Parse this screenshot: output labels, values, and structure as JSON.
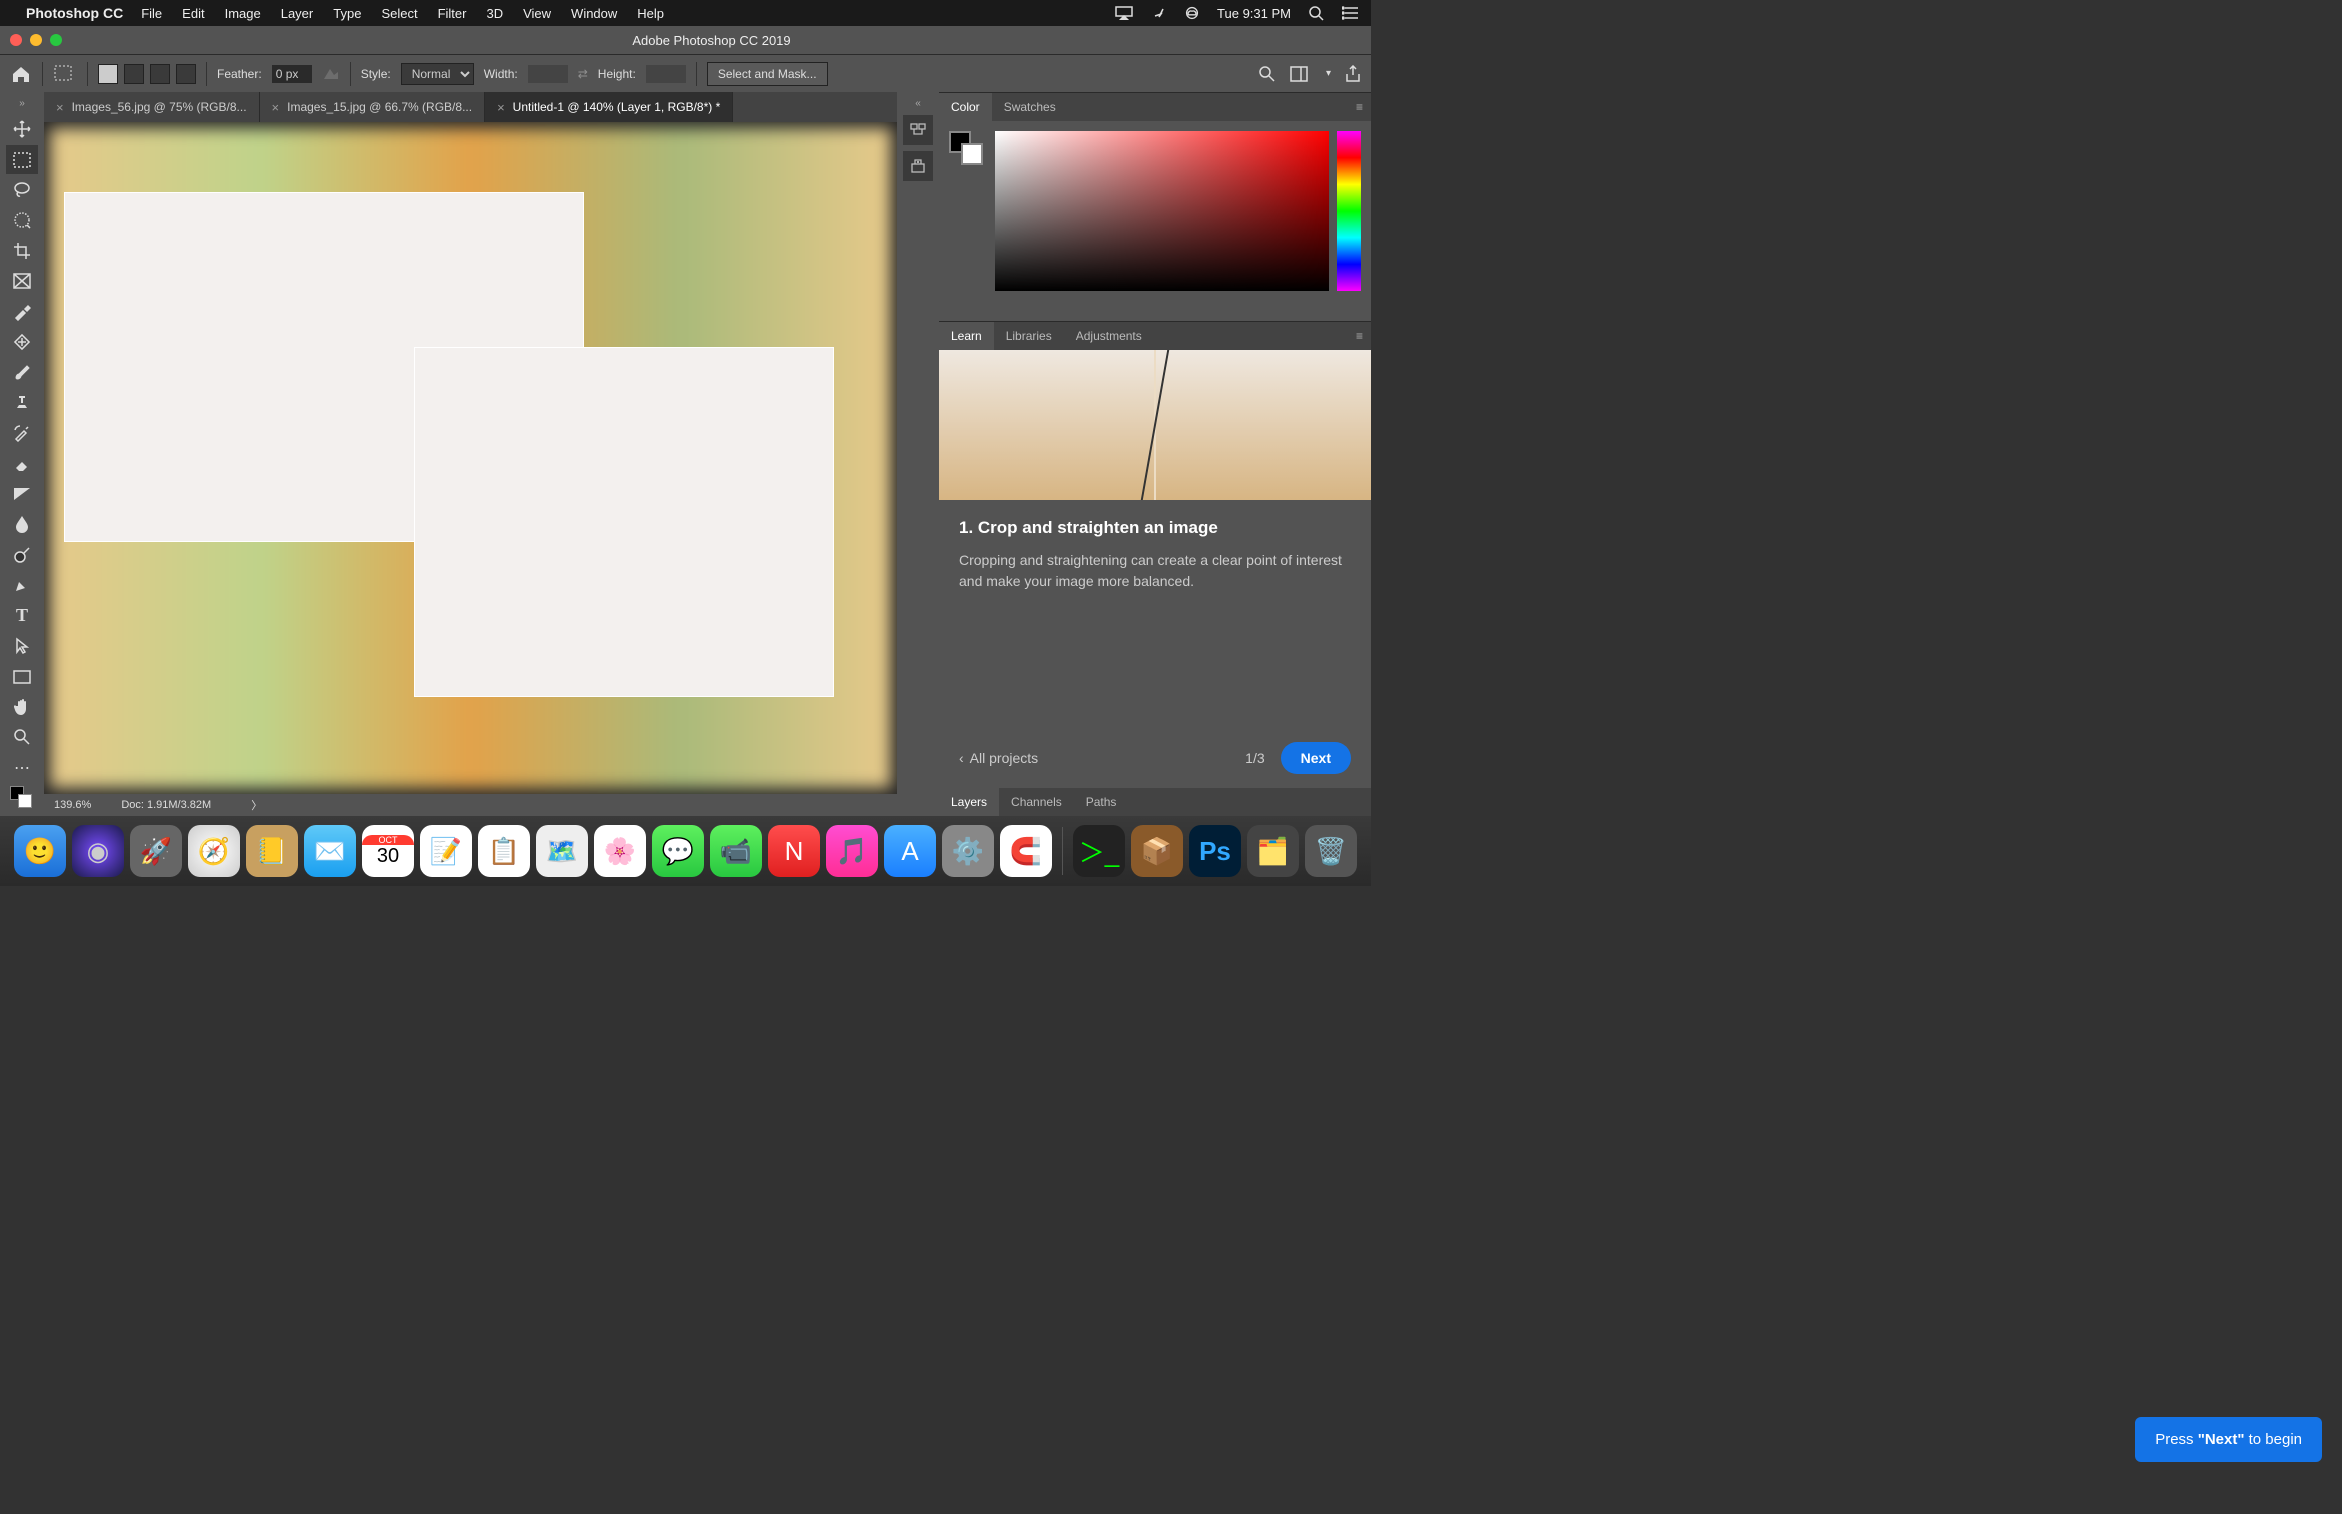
{
  "macos": {
    "app_name": "Photoshop CC",
    "menus": [
      "File",
      "Edit",
      "Image",
      "Layer",
      "Type",
      "Select",
      "Filter",
      "3D",
      "View",
      "Window",
      "Help"
    ],
    "clock": "Tue 9:31 PM"
  },
  "window": {
    "title": "Adobe Photoshop CC 2019"
  },
  "options": {
    "feather_label": "Feather:",
    "feather_value": "0 px",
    "style_label": "Style:",
    "style_value": "Normal",
    "width_label": "Width:",
    "width_value": "",
    "height_label": "Height:",
    "height_value": "",
    "select_mask": "Select and Mask..."
  },
  "doc_tabs": [
    {
      "label": "Images_56.jpg @ 75% (RGB/8...",
      "active": false
    },
    {
      "label": "Images_15.jpg @ 66.7% (RGB/8...",
      "active": false
    },
    {
      "label": "Untitled-1 @ 140% (Layer 1, RGB/8*) *",
      "active": true
    }
  ],
  "status": {
    "zoom": "139.6%",
    "doc": "Doc: 1.91M/3.82M"
  },
  "panels": {
    "color_tabs": [
      "Color",
      "Swatches"
    ],
    "learn_tabs": [
      "Learn",
      "Libraries",
      "Adjustments"
    ],
    "bottom_tabs": [
      "Layers",
      "Channels",
      "Paths"
    ]
  },
  "learn": {
    "title": "1.  Crop and straighten an image",
    "body": "Cropping and straightening can create a clear point of interest and make your image more balanced.",
    "back": "All projects",
    "page": "1/3",
    "next": "Next"
  },
  "tooltip": {
    "prefix": "Press ",
    "bold": "\"Next\"",
    "suffix": " to begin"
  }
}
